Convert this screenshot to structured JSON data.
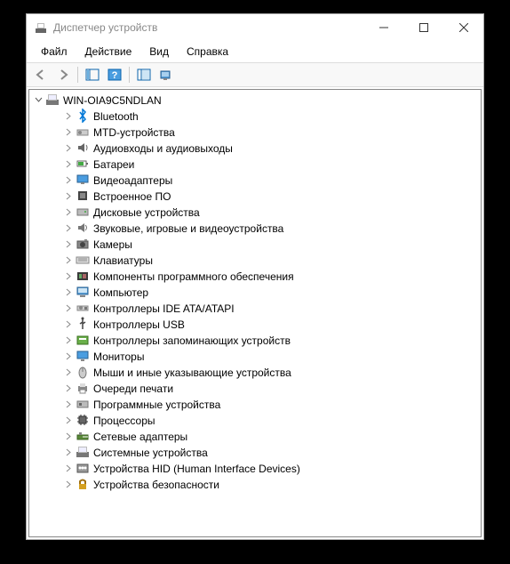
{
  "titlebar": {
    "title": "Диспетчер устройств"
  },
  "menu": {
    "items": [
      "Файл",
      "Действие",
      "Вид",
      "Справка"
    ]
  },
  "tree": {
    "root": "WIN-OIA9C5NDLAN",
    "nodes": [
      {
        "icon": "bluetooth",
        "label": "Bluetooth"
      },
      {
        "icon": "mtd",
        "label": "MTD-устройства"
      },
      {
        "icon": "audio",
        "label": "Аудиовходы и аудиовыходы"
      },
      {
        "icon": "battery",
        "label": "Батареи"
      },
      {
        "icon": "display",
        "label": "Видеоадаптеры"
      },
      {
        "icon": "firmware",
        "label": "Встроенное ПО"
      },
      {
        "icon": "disk",
        "label": "Дисковые устройства"
      },
      {
        "icon": "sound",
        "label": "Звуковые, игровые и видеоустройства"
      },
      {
        "icon": "camera",
        "label": "Камеры"
      },
      {
        "icon": "keyboard",
        "label": "Клавиатуры"
      },
      {
        "icon": "software",
        "label": "Компоненты программного обеспечения"
      },
      {
        "icon": "computer",
        "label": "Компьютер"
      },
      {
        "icon": "ide",
        "label": "Контроллеры IDE ATA/ATAPI"
      },
      {
        "icon": "usb",
        "label": "Контроллеры USB"
      },
      {
        "icon": "storage",
        "label": "Контроллеры запоминающих устройств"
      },
      {
        "icon": "monitor",
        "label": "Мониторы"
      },
      {
        "icon": "mouse",
        "label": "Мыши и иные указывающие устройства"
      },
      {
        "icon": "printer",
        "label": "Очереди печати"
      },
      {
        "icon": "progdev",
        "label": "Программные устройства"
      },
      {
        "icon": "cpu",
        "label": "Процессоры"
      },
      {
        "icon": "network",
        "label": "Сетевые адаптеры"
      },
      {
        "icon": "system",
        "label": "Системные устройства"
      },
      {
        "icon": "hid",
        "label": "Устройства HID (Human Interface Devices)"
      },
      {
        "icon": "security",
        "label": "Устройства безопасности"
      }
    ]
  }
}
